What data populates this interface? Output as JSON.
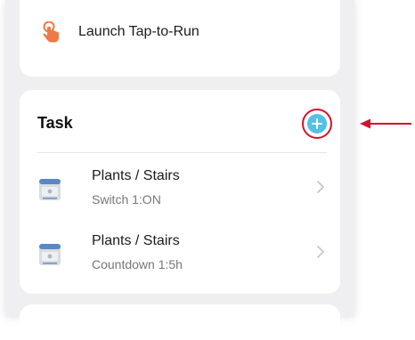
{
  "launch": {
    "label": "Launch Tap-to-Run",
    "icon": "tap-hand-icon",
    "icon_color": "#f07a45"
  },
  "task": {
    "title": "Task",
    "add_icon": "plus-circle-icon",
    "add_color": "#53c0e6",
    "highlight_color": "#d2122e",
    "items": [
      {
        "name": "Plants / Stairs",
        "detail": "Switch 1:ON",
        "icon": "smart-switch-device-icon"
      },
      {
        "name": "Plants / Stairs",
        "detail": "Countdown 1:5h",
        "icon": "smart-switch-device-icon"
      }
    ]
  },
  "annotation": {
    "arrow_icon": "red-arrow-pointer",
    "arrow_color": "#d2122e"
  }
}
